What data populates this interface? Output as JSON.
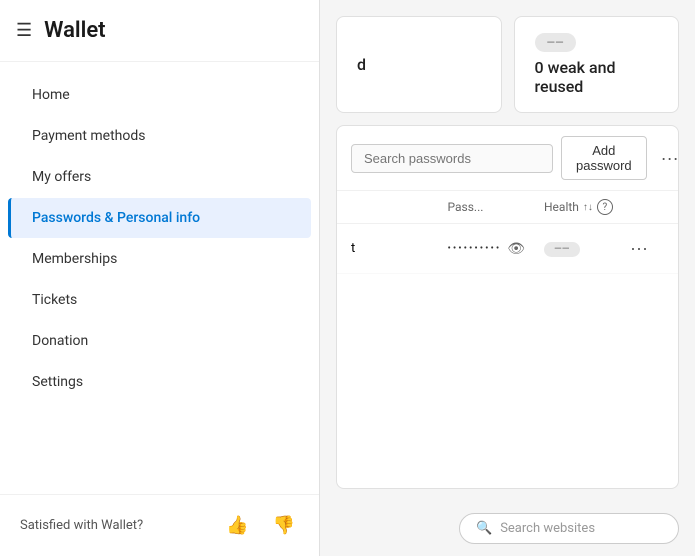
{
  "sidebar": {
    "title": "Wallet",
    "hamburger": "☰",
    "nav_items": [
      {
        "id": "home",
        "label": "Home",
        "active": false
      },
      {
        "id": "payment-methods",
        "label": "Payment methods",
        "active": false
      },
      {
        "id": "my-offers",
        "label": "My offers",
        "active": false
      },
      {
        "id": "passwords-personal-info",
        "label": "Passwords & Personal info",
        "active": true
      },
      {
        "id": "memberships",
        "label": "Memberships",
        "active": false
      },
      {
        "id": "tickets",
        "label": "Tickets",
        "active": false
      },
      {
        "id": "donation",
        "label": "Donation",
        "active": false
      },
      {
        "id": "settings",
        "label": "Settings",
        "active": false
      }
    ],
    "footer": {
      "text": "Satisfied with Wallet?",
      "thumbs_up": "👍",
      "thumbs_down": "👎"
    }
  },
  "main": {
    "cards": {
      "left": {
        "suffix": "d"
      },
      "right": {
        "badge": "——",
        "value": "0 weak and reused"
      }
    },
    "toolbar": {
      "search_placeholder": "Search passwords",
      "add_button": "Add password",
      "more": "···"
    },
    "table": {
      "headers": {
        "password": "Pass...",
        "health": "Health",
        "sort": "↑↓",
        "help": "?"
      },
      "rows": [
        {
          "site": "t",
          "password": "••••••••••",
          "health_badge": "——",
          "actions": "···"
        }
      ]
    },
    "search_websites": {
      "placeholder": "Search websites",
      "icon": "🔍"
    }
  }
}
